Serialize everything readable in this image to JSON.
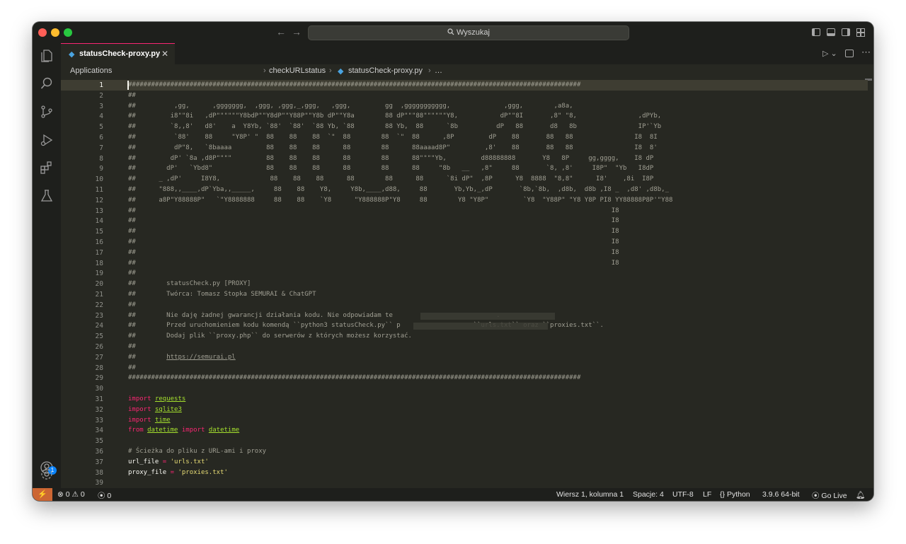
{
  "window": {
    "search_placeholder": "Wyszukaj",
    "nav_back": "←",
    "nav_forward": "→"
  },
  "tab": {
    "label": "statusCheck-proxy.py",
    "icon": "python-file-icon",
    "close": "✕"
  },
  "breadcrumb": {
    "root": "Applications",
    "folder": "checkURLstatus",
    "file": "statusCheck-proxy.py",
    "tail": "…",
    "sep": "›"
  },
  "editor": {
    "lines": [
      {
        "n": "1",
        "text": "######################################################################################################################"
      },
      {
        "n": "2",
        "text": "##"
      },
      {
        "n": "3",
        "text": "##          ,gg,      ,ggggggg,  ,ggg, ,ggg,_,ggg,   ,ggg,         gg  ,ggggggggggg,              ,ggg,        ,a8a,"
      },
      {
        "n": "4",
        "text": "##         i8\"\"8i   ,dP\"\"\"\"\"\"Y8bdP\"\"Y8dP\"\"Y88P\"\"Y8b dP\"\"Y8a        88 dP\"\"\"88\"\"\"\"\"\"Y8,           dP\"\"8I       ,8\" \"8,                ,dPYb,"
      },
      {
        "n": "5",
        "text": "##         `8,,8'   d8'    a  Y8Yb, `88'  `88'  `88 Yb, `88        88 Yb,  88      `8b          dP   88       d8   8b                IP'`Yb"
      },
      {
        "n": "6",
        "text": "##          `88'    88     \"Y8P' \"  88    88    88  `\"  88        88  `\"  88      ,8P         dP    88       88   88                I8  8I"
      },
      {
        "n": "7",
        "text": "##          dP\"8,   `8baaaa         88    88    88      88        88      88aaaad8P\"         ,8'    88       88   88                I8  8'"
      },
      {
        "n": "8",
        "text": "##         dP' `8a ,d8P\"\"\"\"         88    88    88      88        88      88\"\"\"\"Yb,         d88888888       Y8   8P     gg,gggg,    I8 dP"
      },
      {
        "n": "9",
        "text": "##        dP'   `Ybd8\"              88    88    88      88        88      88     \"8b   __   ,8\"     88       `8, ,8'     I8P\"  \"Yb   I8dP"
      },
      {
        "n": "10",
        "text": "##      _ ,dP'     I8Y8,             88    88    88      88        88      88      `8i dP\"  ,8P      Y8  8888  \"8,8\"      I8'    ,8i  I8P"
      },
      {
        "n": "11",
        "text": "##      \"888,,____,dP`Yba,,_____,     88    88    Y8,     Y8b,____,d88,     88       Yb,Yb,_,dP       `8b,`8b,  ,d8b,  d8b ,I8 _  ,d8' ,d8b,_"
      },
      {
        "n": "12",
        "text": "##      a8P\"Y88888P\"   `\"Y8888888     88    88    `Y8      \"Y888888P\"Y8     88        Y8 \"Y8P\"         `Y8  \"Y88P\" \"Y8 Y8P PI8 YY88888P8P'\"Y88"
      },
      {
        "n": "13",
        "text": "##                                                                                                                            I8"
      },
      {
        "n": "14",
        "text": "##                                                                                                                            I8"
      },
      {
        "n": "15",
        "text": "##                                                                                                                            I8"
      },
      {
        "n": "16",
        "text": "##                                                                                                                            I8"
      },
      {
        "n": "17",
        "text": "##                                                                                                                            I8"
      },
      {
        "n": "18",
        "text": "##                                                                                                                            I8"
      },
      {
        "n": "19",
        "text": "##"
      },
      {
        "n": "20",
        "text": "##        statusCheck.py [PROXY]"
      },
      {
        "n": "21",
        "text": "##        Twórca: Tomasz Stopka SEMURAI & ChatGPT"
      },
      {
        "n": "22",
        "text": "##"
      },
      {
        "n": "23",
        "text": "##        Nie daję żadnej gwarancji działania kodu. Nie odpowiadam te                           ."
      },
      {
        "n": "24",
        "text": "##        Przed uruchomieniem kodu komendą ``python3 statusCheck.py`` p                   ``urls.txt`` oraz ``proxies.txt``."
      },
      {
        "n": "25",
        "text": "##        Dodaj plik ``proxy.php`` do serwerów z których możesz korzystać."
      },
      {
        "n": "26",
        "text": "##"
      },
      {
        "n": "27",
        "text": "##        https://semurai.pl"
      },
      {
        "n": "28",
        "text": "##"
      },
      {
        "n": "29",
        "text": "######################################################################################################################"
      },
      {
        "n": "30",
        "text": ""
      },
      {
        "n": "31",
        "text": "import requests"
      },
      {
        "n": "32",
        "text": "import sqlite3"
      },
      {
        "n": "33",
        "text": "import time"
      },
      {
        "n": "34",
        "text": "from datetime import datetime"
      },
      {
        "n": "35",
        "text": ""
      },
      {
        "n": "36",
        "text": "# Ścieżka do pliku z URL-ami i proxy"
      },
      {
        "n": "37",
        "text": "url_file = 'urls.txt'"
      },
      {
        "n": "38",
        "text": "proxy_file = 'proxies.txt'"
      },
      {
        "n": "39",
        "text": ""
      }
    ],
    "import_kw": "import",
    "from_kw": "from",
    "modules": [
      "requests",
      "sqlite3",
      "time",
      "datetime"
    ],
    "url_var": "url_file",
    "url_val": "'urls.txt'",
    "proxy_var": "proxy_file",
    "proxy_val": "'proxies.txt'",
    "eq": "="
  },
  "status": {
    "errors": "0",
    "warnings": "0",
    "ports": "0",
    "position": "Wiersz 1, kolumna 1",
    "spaces": "Spacje: 4",
    "encoding": "UTF-8",
    "eol": "LF",
    "language": "Python",
    "interpreter": "3.9.6 64-bit",
    "golive": "Go Live"
  },
  "colors": {
    "remote": "#cc6633",
    "keyword": "#f92672",
    "module": "#a6e22e",
    "string": "#e6db74",
    "background": "#272822"
  }
}
